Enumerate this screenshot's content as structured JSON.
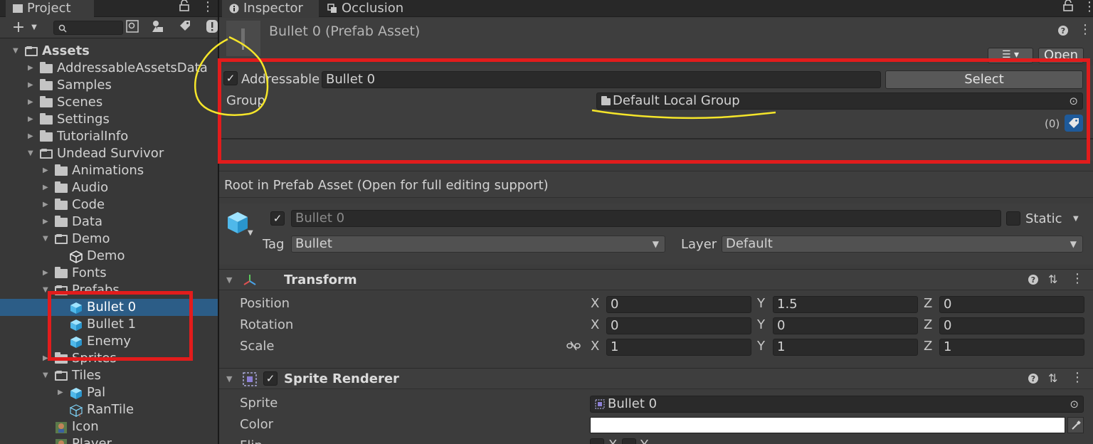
{
  "project": {
    "tab_label": "Project",
    "add_label": "+",
    "tree": [
      {
        "label": "Assets",
        "type": "folder",
        "expanded": true,
        "indent": 0
      },
      {
        "label": "AddressableAssetsData",
        "type": "folder",
        "indent": 1
      },
      {
        "label": "Samples",
        "type": "folder",
        "indent": 1
      },
      {
        "label": "Scenes",
        "type": "folder",
        "indent": 1
      },
      {
        "label": "Settings",
        "type": "folder",
        "indent": 1
      },
      {
        "label": "TutorialInfo",
        "type": "folder",
        "indent": 1
      },
      {
        "label": "Undead Survivor",
        "type": "folder",
        "expanded": true,
        "indent": 1
      },
      {
        "label": "Animations",
        "type": "folder",
        "indent": 2
      },
      {
        "label": "Audio",
        "type": "folder",
        "indent": 2
      },
      {
        "label": "Code",
        "type": "folder",
        "indent": 2
      },
      {
        "label": "Data",
        "type": "folder",
        "indent": 2
      },
      {
        "label": "Demo",
        "type": "folder",
        "expanded": true,
        "indent": 2
      },
      {
        "label": "Demo",
        "type": "unity",
        "indent": 3
      },
      {
        "label": "Fonts",
        "type": "folder",
        "indent": 2
      },
      {
        "label": "Prefabs",
        "type": "folder",
        "expanded": true,
        "indent": 2
      },
      {
        "label": "Bullet 0",
        "type": "prefab",
        "indent": 3,
        "selected": true
      },
      {
        "label": "Bullet 1",
        "type": "prefab",
        "indent": 3
      },
      {
        "label": "Enemy",
        "type": "prefab",
        "indent": 3
      },
      {
        "label": "Sprites",
        "type": "folder",
        "indent": 2
      },
      {
        "label": "Tiles",
        "type": "folder",
        "expanded": true,
        "indent": 2
      },
      {
        "label": "Pal",
        "type": "prefab",
        "indent": 3,
        "arrow": true
      },
      {
        "label": "RanTile",
        "type": "tile",
        "indent": 3
      },
      {
        "label": "Icon",
        "type": "image",
        "indent": 2
      },
      {
        "label": "Player",
        "type": "image",
        "indent": 2
      }
    ]
  },
  "inspector": {
    "tab_label": "Inspector",
    "occlusion_tab_label": "Occlusion",
    "title": "Bullet 0 (Prefab Asset)",
    "open_label": "Open",
    "addressable": {
      "label": "Addressable",
      "checked": true,
      "address": "Bullet 0",
      "select_label": "Select",
      "group_label": "Group",
      "group_value": "Default Local Group",
      "labels_count": "(0)"
    },
    "root_notice": "Root in Prefab Asset (Open for full editing support)",
    "gameobject": {
      "name": "Bullet 0",
      "static_label": "Static",
      "tag_label": "Tag",
      "tag_value": "Bullet",
      "layer_label": "Layer",
      "layer_value": "Default"
    },
    "transform": {
      "title": "Transform",
      "rows": [
        {
          "label": "Position",
          "x": "0",
          "y": "1.5",
          "z": "0"
        },
        {
          "label": "Rotation",
          "x": "0",
          "y": "0",
          "z": "0"
        },
        {
          "label": "Scale",
          "x": "1",
          "y": "1",
          "z": "1"
        }
      ],
      "axis_x": "X",
      "axis_y": "Y",
      "axis_z": "Z"
    },
    "sprite_renderer": {
      "title": "Sprite Renderer",
      "sprite_label": "Sprite",
      "sprite_value": "Bullet 0",
      "color_label": "Color",
      "color_value": "#ffffff",
      "flip_label": "Flip",
      "flip_x": "X",
      "flip_y": "Y"
    }
  },
  "colors": {
    "selection": "#2c5d87",
    "annotation_red": "#e21c1c",
    "annotation_yellow": "#f5e52a"
  }
}
